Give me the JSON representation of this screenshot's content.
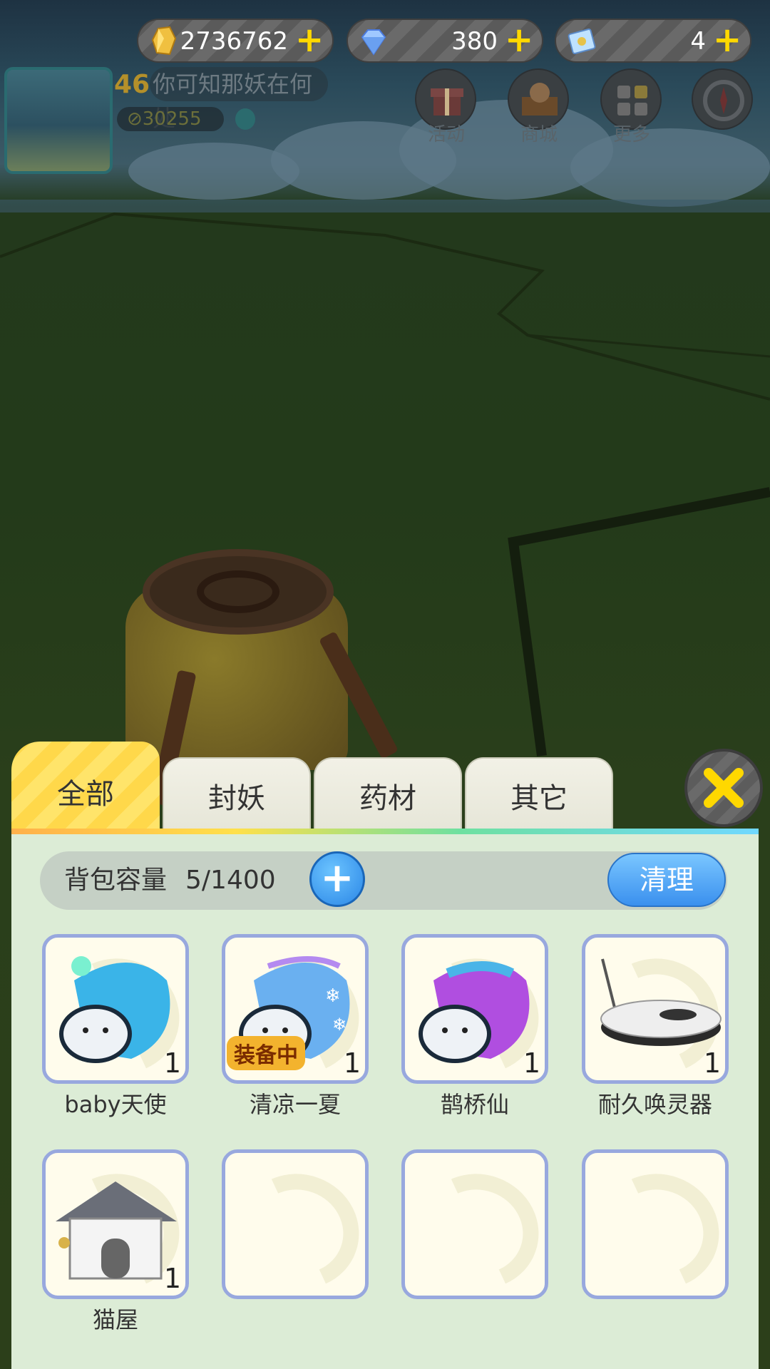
{
  "currencies": [
    {
      "icon": "gold-crystal-icon",
      "value": "2736762",
      "plus": "+"
    },
    {
      "icon": "diamond-icon",
      "value": "380",
      "plus": "+"
    },
    {
      "icon": "ticket-icon",
      "value": "4",
      "plus": "+"
    }
  ],
  "player": {
    "level": "46",
    "quest": "你可知那妖在何处",
    "power": "30255"
  },
  "top_menu": [
    {
      "icon": "gift-icon",
      "label": "活动"
    },
    {
      "icon": "shop-icon",
      "label": "商城"
    },
    {
      "icon": "more-grid-icon",
      "label": "更多"
    },
    {
      "icon": "compass-icon",
      "label": ""
    }
  ],
  "tabs": [
    {
      "label": "全部",
      "active": true
    },
    {
      "label": "封妖",
      "active": false
    },
    {
      "label": "药材",
      "active": false
    },
    {
      "label": "其它",
      "active": false
    }
  ],
  "capacity": {
    "label": "背包容量",
    "value": "5/1400",
    "add_icon": "plus-icon",
    "clean_label": "清理"
  },
  "items": [
    {
      "name": "baby天使",
      "count": "1",
      "icon": "angel-snail-icon",
      "equipped": ""
    },
    {
      "name": "清凉一夏",
      "count": "1",
      "icon": "snowflake-snail-icon",
      "equipped": "装备中"
    },
    {
      "name": "鹊桥仙",
      "count": "1",
      "icon": "purple-snail-icon",
      "equipped": ""
    },
    {
      "name": "耐久唤灵器",
      "count": "1",
      "icon": "summoner-device-icon",
      "equipped": ""
    },
    {
      "name": "猫屋",
      "count": "1",
      "icon": "cat-house-icon",
      "equipped": ""
    },
    {
      "name": "",
      "count": "",
      "icon": "",
      "equipped": ""
    },
    {
      "name": "",
      "count": "",
      "icon": "",
      "equipped": ""
    },
    {
      "name": "",
      "count": "",
      "icon": "",
      "equipped": ""
    }
  ],
  "close_icon": "close-x-icon",
  "colors": {
    "accent_yellow": "#ffd84a",
    "button_blue": "#3a90ee",
    "slot_border": "#98a8de",
    "panel_bg": "#dcecd6"
  }
}
